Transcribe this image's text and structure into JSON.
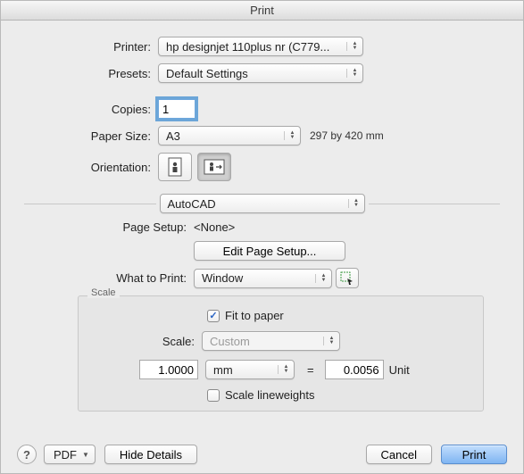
{
  "window": {
    "title": "Print"
  },
  "printer": {
    "label": "Printer:",
    "value": "hp designjet 110plus nr (C779..."
  },
  "presets": {
    "label": "Presets:",
    "value": "Default Settings"
  },
  "copies": {
    "label": "Copies:",
    "value": "1"
  },
  "paperSize": {
    "label": "Paper Size:",
    "value": "A3",
    "hint": "297 by 420 mm"
  },
  "orientation": {
    "label": "Orientation:"
  },
  "section": {
    "value": "AutoCAD"
  },
  "pageSetup": {
    "label": "Page Setup:",
    "value": "<None>"
  },
  "editPageSetup": {
    "label": "Edit Page Setup..."
  },
  "whatToPrint": {
    "label": "What to Print:",
    "value": "Window"
  },
  "scale": {
    "legend": "Scale",
    "fitLabel": "Fit to paper",
    "fitChecked": true,
    "label": "Scale:",
    "value": "Custom",
    "left": "1.0000",
    "unitSel": "mm",
    "eq": "=",
    "right": "0.0056",
    "unit": "Unit",
    "lineweightsLabel": "Scale lineweights",
    "lineweightsChecked": false
  },
  "footer": {
    "pdf": "PDF",
    "hideDetails": "Hide Details",
    "cancel": "Cancel",
    "print": "Print"
  }
}
